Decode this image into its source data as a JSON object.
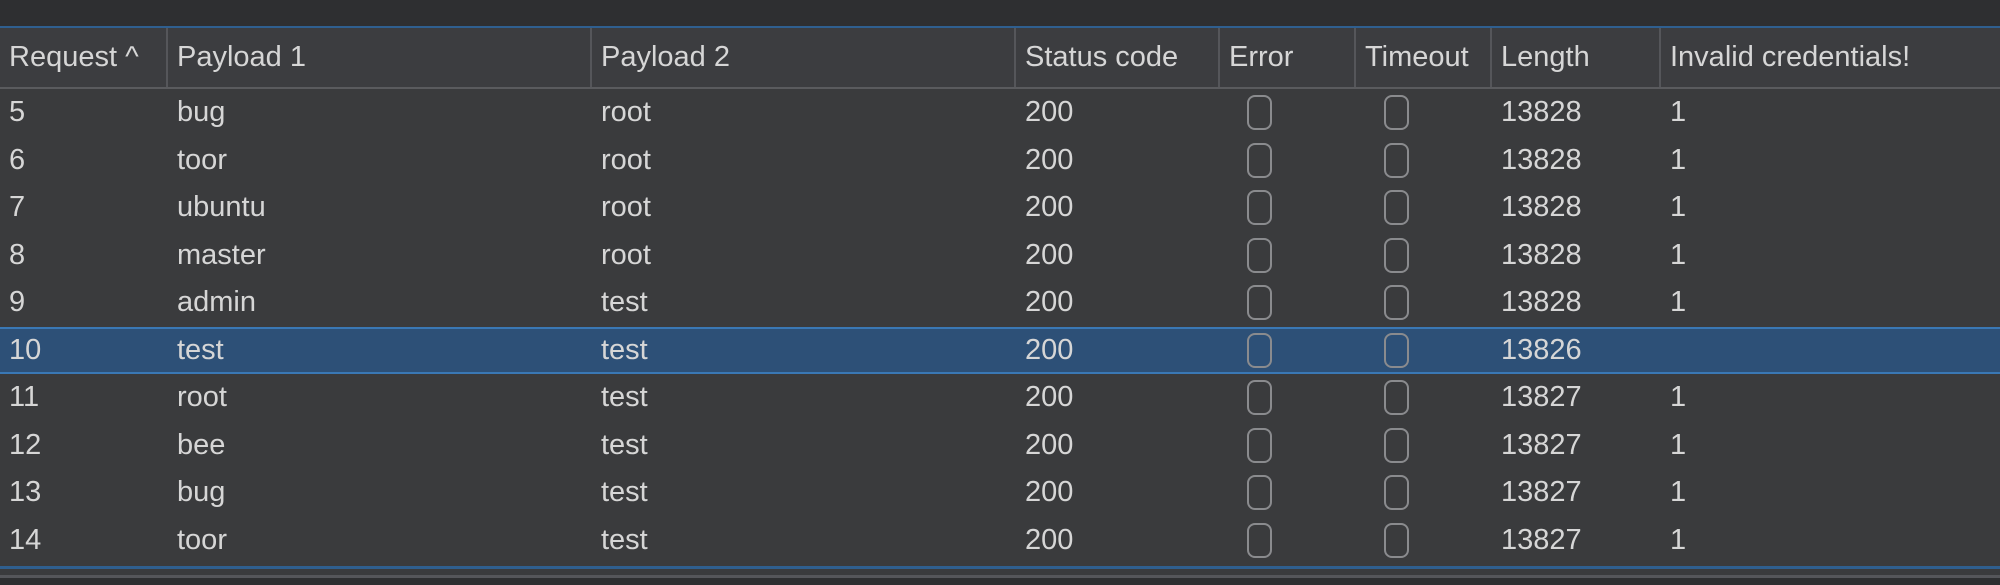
{
  "table": {
    "columns": [
      "Request ^",
      "Payload 1",
      "Payload 2",
      "Status code",
      "Error",
      "Timeout",
      "Length",
      "Invalid credentials!"
    ],
    "sort": {
      "column": "Request",
      "direction": "ascending"
    },
    "selected_request": "10",
    "rows": [
      {
        "request": "5",
        "payload1": "bug",
        "payload2": "root",
        "status": "200",
        "error": false,
        "timeout": false,
        "length": "13828",
        "invalid": "1"
      },
      {
        "request": "6",
        "payload1": "toor",
        "payload2": "root",
        "status": "200",
        "error": false,
        "timeout": false,
        "length": "13828",
        "invalid": "1"
      },
      {
        "request": "7",
        "payload1": "ubuntu",
        "payload2": "root",
        "status": "200",
        "error": false,
        "timeout": false,
        "length": "13828",
        "invalid": "1"
      },
      {
        "request": "8",
        "payload1": "master",
        "payload2": "root",
        "status": "200",
        "error": false,
        "timeout": false,
        "length": "13828",
        "invalid": "1"
      },
      {
        "request": "9",
        "payload1": "admin",
        "payload2": "test",
        "status": "200",
        "error": false,
        "timeout": false,
        "length": "13828",
        "invalid": "1"
      },
      {
        "request": "10",
        "payload1": "test",
        "payload2": "test",
        "status": "200",
        "error": false,
        "timeout": false,
        "length": "13826",
        "invalid": ""
      },
      {
        "request": "11",
        "payload1": "root",
        "payload2": "test",
        "status": "200",
        "error": false,
        "timeout": false,
        "length": "13827",
        "invalid": "1"
      },
      {
        "request": "12",
        "payload1": "bee",
        "payload2": "test",
        "status": "200",
        "error": false,
        "timeout": false,
        "length": "13827",
        "invalid": "1"
      },
      {
        "request": "13",
        "payload1": "bug",
        "payload2": "test",
        "status": "200",
        "error": false,
        "timeout": false,
        "length": "13827",
        "invalid": "1"
      },
      {
        "request": "14",
        "payload1": "toor",
        "payload2": "test",
        "status": "200",
        "error": false,
        "timeout": false,
        "length": "13827",
        "invalid": "1"
      }
    ]
  },
  "colors": {
    "background": "#3a3b3d",
    "selection": "#2d5077",
    "accent": "#3a78b5"
  }
}
